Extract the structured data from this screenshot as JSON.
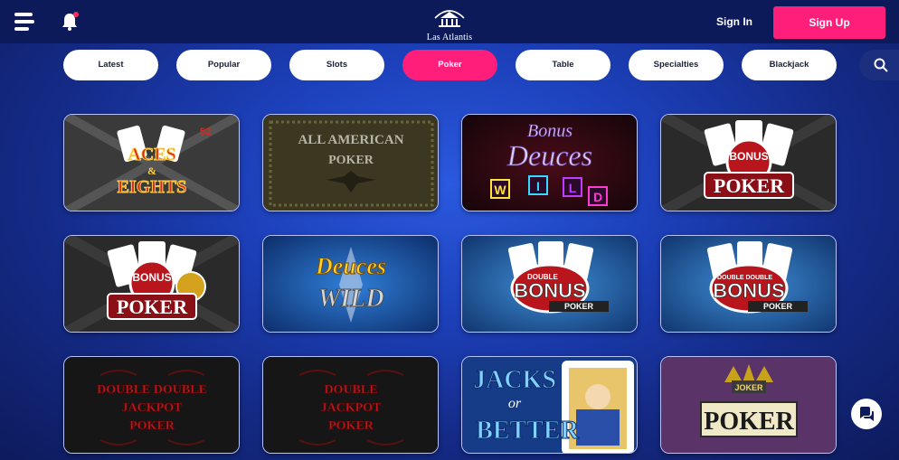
{
  "header": {
    "brand": "Las Atlantis",
    "signin_label": "Sign In",
    "signup_label": "Sign Up"
  },
  "tabs": [
    {
      "label": "Latest",
      "active": false
    },
    {
      "label": "Popular",
      "active": false
    },
    {
      "label": "Slots",
      "active": false
    },
    {
      "label": "Poker",
      "active": true
    },
    {
      "label": "Table",
      "active": false
    },
    {
      "label": "Specialties",
      "active": false
    },
    {
      "label": "Blackjack",
      "active": false
    }
  ],
  "games": [
    {
      "title_lines": [
        "ACES",
        "&",
        "EIGHTS"
      ],
      "badge": "52"
    },
    {
      "title_lines": [
        "ALL AMERICAN",
        "POKER"
      ]
    },
    {
      "title_lines": [
        "Bonus",
        "Deuces",
        "W",
        "I",
        "L",
        "D"
      ]
    },
    {
      "title_lines": [
        "BONUS",
        "POKER"
      ]
    },
    {
      "title_lines": [
        "BONUS",
        "POKER"
      ]
    },
    {
      "title_lines": [
        "Deuces",
        "WILD"
      ]
    },
    {
      "title_lines": [
        "DOUBLE",
        "BONUS",
        "POKER"
      ]
    },
    {
      "title_lines": [
        "DOUBLE DOUBLE",
        "BONUS",
        "POKER"
      ]
    },
    {
      "title_lines": [
        "DOUBLE DOUBLE",
        "JACKPOT",
        "POKER"
      ]
    },
    {
      "title_lines": [
        "DOUBLE",
        "JACKPOT",
        "POKER"
      ]
    },
    {
      "title_lines": [
        "JACKS",
        "or",
        "BETTER"
      ]
    },
    {
      "title_lines": [
        "JOKER",
        "POKER"
      ]
    }
  ],
  "colors": {
    "accent": "#ff1f7a",
    "topbar": "#0c1a5a",
    "tab_bg": "#ffffff"
  },
  "icons": {
    "menu": "hamburger-menu-icon",
    "notification": "bell-icon",
    "search": "search-icon",
    "chat": "chat-icon"
  }
}
